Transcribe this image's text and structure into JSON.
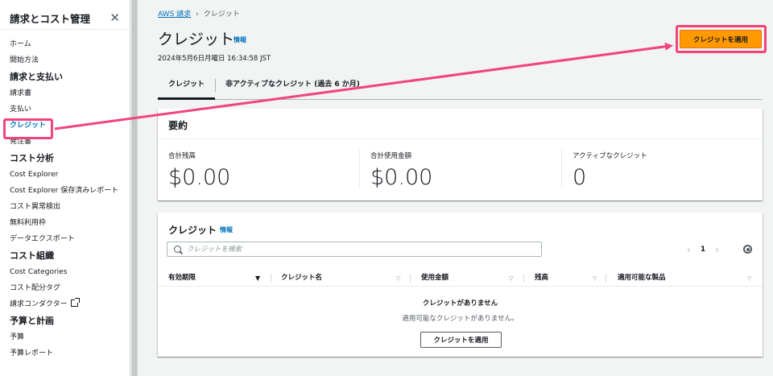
{
  "sidebar": {
    "title": "請求とコスト管理",
    "items": [
      {
        "label": "ホーム",
        "type": "item"
      },
      {
        "label": "開始方法",
        "type": "item"
      },
      {
        "label": "請求と支払い",
        "type": "section"
      },
      {
        "label": "請求書",
        "type": "item"
      },
      {
        "label": "支払い",
        "type": "item"
      },
      {
        "label": "クレジット",
        "type": "item",
        "active": true
      },
      {
        "label": "発注書",
        "type": "item"
      },
      {
        "label": "コスト分析",
        "type": "section"
      },
      {
        "label": "Cost Explorer",
        "type": "item"
      },
      {
        "label": "Cost Explorer 保存済みレポート",
        "type": "item"
      },
      {
        "label": "コスト異常検出",
        "type": "item"
      },
      {
        "label": "無料利用枠",
        "type": "item"
      },
      {
        "label": "データエクスポート",
        "type": "item"
      },
      {
        "label": "コスト組織",
        "type": "section"
      },
      {
        "label": "Cost Categories",
        "type": "item"
      },
      {
        "label": "コスト配分タグ",
        "type": "item"
      },
      {
        "label": "請求コンダクター",
        "type": "item",
        "external": true
      },
      {
        "label": "予算と計画",
        "type": "section"
      },
      {
        "label": "予算",
        "type": "item"
      },
      {
        "label": "予算レポート",
        "type": "item"
      }
    ]
  },
  "breadcrumb": {
    "root": "AWS 請求",
    "current": "クレジット"
  },
  "page": {
    "title": "クレジット",
    "info": "情報",
    "date": "2024年5月6日月曜日 16:34:58 JST",
    "apply_button": "クレジットを適用"
  },
  "tabs": [
    {
      "label": "クレジット",
      "active": true
    },
    {
      "label": "非アクティブなクレジット (過去 6 か月)",
      "active": false
    }
  ],
  "summary": {
    "title": "要約",
    "kpis": [
      {
        "label": "合計残高",
        "value": "$0.00"
      },
      {
        "label": "合計使用金額",
        "value": "$0.00"
      },
      {
        "label": "アクティブなクレジット",
        "value": "0"
      }
    ]
  },
  "credits": {
    "title": "クレジット",
    "info": "情報",
    "search_placeholder": "クレジットを検索",
    "page": "1",
    "columns": [
      "有効期限",
      "クレジット名",
      "使用金額",
      "残高",
      "適用可能な製品"
    ],
    "empty_title": "クレジットがありません",
    "empty_desc": "適用可能なクレジットがありません。",
    "apply_button": "クレジットを適用"
  },
  "colors": {
    "accent": "#0073bb",
    "primary_button": "#ff9900",
    "highlight": "#f0457a"
  },
  "icons": [
    "close-icon",
    "external-link-icon",
    "search-icon",
    "chevron-left-icon",
    "chevron-right-icon",
    "gear-icon",
    "sort-down-icon",
    "sort-icon"
  ]
}
